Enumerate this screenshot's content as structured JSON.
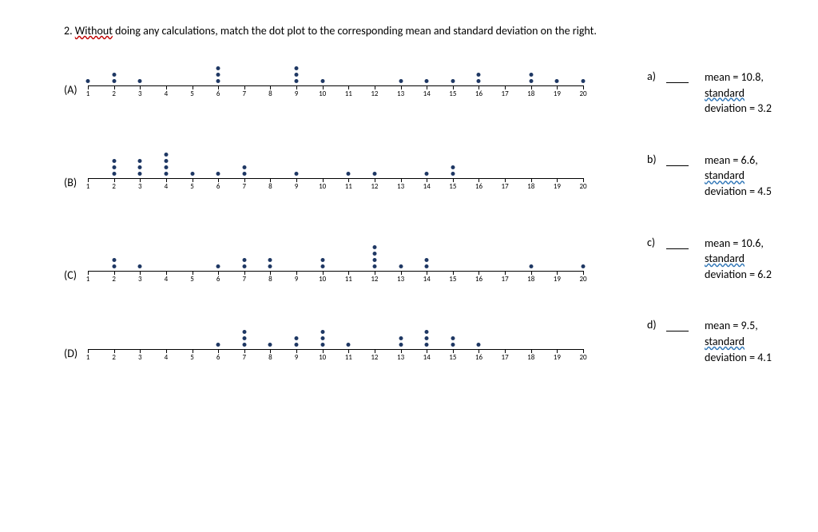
{
  "question_prefix": "2. ",
  "question_emphasis": "Without",
  "question_rest": " doing any calculations, match the dot plot to the corresponding mean and standard deviation on the right.",
  "axis": {
    "min": 1,
    "max": 20,
    "step": 1
  },
  "chart_data": [
    {
      "label": "(A)",
      "type": "dotplot",
      "x_values": [
        1,
        2,
        3,
        4,
        5,
        6,
        7,
        8,
        9,
        10,
        11,
        12,
        13,
        14,
        15,
        16,
        17,
        18,
        19,
        20
      ],
      "counts": {
        "1": 1,
        "2": 2,
        "3": 1,
        "6": 3,
        "9": 3,
        "10": 1,
        "13": 1,
        "14": 1,
        "15": 1,
        "16": 2,
        "18": 2,
        "19": 1,
        "20": 1
      }
    },
    {
      "label": "(B)",
      "type": "dotplot",
      "x_values": [
        1,
        2,
        3,
        4,
        5,
        6,
        7,
        8,
        9,
        10,
        11,
        12,
        13,
        14,
        15,
        16,
        17,
        18,
        19,
        20
      ],
      "counts": {
        "2": 3,
        "3": 3,
        "4": 4,
        "5": 1,
        "6": 1,
        "7": 2,
        "9": 1,
        "11": 1,
        "12": 1,
        "14": 1,
        "15": 2
      }
    },
    {
      "label": "(C)",
      "type": "dotplot",
      "x_values": [
        1,
        2,
        3,
        4,
        5,
        6,
        7,
        8,
        9,
        10,
        11,
        12,
        13,
        14,
        15,
        16,
        17,
        18,
        19,
        20
      ],
      "counts": {
        "2": 2,
        "3": 1,
        "6": 1,
        "7": 2,
        "8": 2,
        "10": 2,
        "12": 4,
        "13": 1,
        "14": 2,
        "18": 1,
        "20": 1
      }
    },
    {
      "label": "(D)",
      "type": "dotplot",
      "x_values": [
        1,
        2,
        3,
        4,
        5,
        6,
        7,
        8,
        9,
        10,
        11,
        12,
        13,
        14,
        15,
        16,
        17,
        18,
        19,
        20
      ],
      "counts": {
        "6": 1,
        "7": 3,
        "8": 1,
        "9": 2,
        "10": 3,
        "11": 1,
        "13": 2,
        "14": 3,
        "15": 2,
        "16": 1
      }
    }
  ],
  "answers": [
    {
      "label": "a)",
      "mean_text": "mean = 10.8,",
      "sd_word": "standard",
      "sd_rest": " deviation = 3.2"
    },
    {
      "label": "b)",
      "mean_text": "mean = 6.6,",
      "sd_word": "standard",
      "sd_rest": " deviation = 4.5"
    },
    {
      "label": "c)",
      "mean_text": "mean = 10.6,",
      "sd_word": "standard",
      "sd_rest": " deviation = 6.2"
    },
    {
      "label": "d)",
      "mean_text": "mean = 9.5,",
      "sd_word": "standard",
      "sd_rest": " deviation = 4.1"
    }
  ]
}
